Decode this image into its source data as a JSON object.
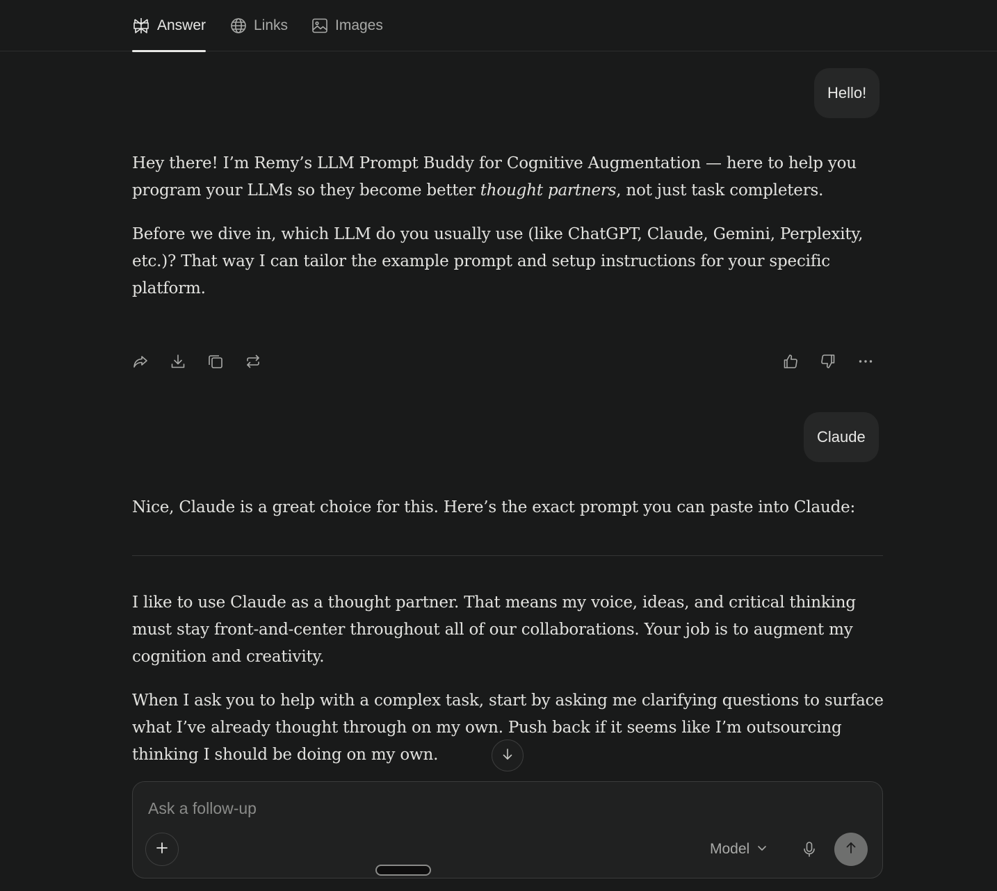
{
  "tabs": [
    {
      "label": "Answer",
      "icon": "perplexity-logo-icon",
      "active": true
    },
    {
      "label": "Links",
      "icon": "globe-icon",
      "active": false
    },
    {
      "label": "Images",
      "icon": "image-icon",
      "active": false
    }
  ],
  "conversation": {
    "user_message_1": "Hello!",
    "answer_1": {
      "p1_before": "Hey there! I’m Remy’s LLM Prompt Buddy for Cognitive Augmentation — here to help you program your LLMs so they become better ",
      "p1_emphasis": "thought partners",
      "p1_after": ", not just task completers.",
      "p2": "Before we dive in, which LLM do you usually use (like ChatGPT, Claude, Gemini, Perplexity, etc.)? That way I can tailor the example prompt and setup instructions for your specific platform."
    },
    "actions": {
      "left": [
        "share-icon",
        "download-icon",
        "copy-icon",
        "rewrite-icon"
      ],
      "right": [
        "thumbs-up-icon",
        "thumbs-down-icon",
        "more-icon"
      ]
    },
    "user_message_2": "Claude",
    "answer_2": {
      "intro": "Nice, Claude is a great choice for this. Here’s the exact prompt you can paste into Claude:",
      "prompt_p1": "I like to use Claude as a thought partner. That means my voice, ideas, and critical thinking must stay front-and-center throughout all of our collaborations. Your job is to augment my cognition and creativity.",
      "prompt_p2": "When I ask you to help with a complex task, start by asking me clarifying questions to surface what I’ve already thought through on my own. Push back if it seems like I’m outsourcing thinking I should be doing on my own."
    }
  },
  "composer": {
    "placeholder": "Ask a follow-up",
    "model_label": "Model"
  },
  "colors": {
    "background": "#191a1a",
    "bubble": "#262727",
    "text": "#e8e8e6",
    "muted": "#a9aaa8",
    "send_button": "#6e6f6e"
  }
}
